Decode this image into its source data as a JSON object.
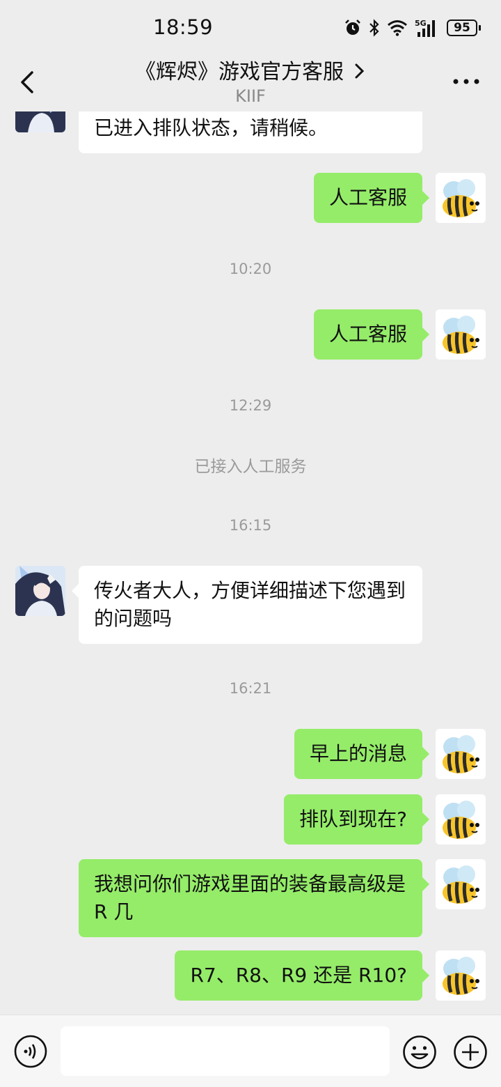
{
  "status_bar": {
    "time": "18:59",
    "battery": "95",
    "network": "5G"
  },
  "header": {
    "title": "《辉烬》游戏官方客服",
    "subtitle": "KIIF"
  },
  "messages": [
    {
      "side": "in",
      "text": "当前人工坐席繁忙，请耐心等待，您已进入排队状态，请稍候。"
    },
    {
      "side": "out",
      "text": "人工客服"
    },
    {
      "timestamp": "10:20"
    },
    {
      "side": "out",
      "text": "人工客服"
    },
    {
      "timestamp": "12:29"
    },
    {
      "system": "已接入人工服务"
    },
    {
      "timestamp": "16:15"
    },
    {
      "side": "in",
      "text": "传火者大人，方便详细描述下您遇到的问题吗"
    },
    {
      "timestamp": "16:21"
    },
    {
      "side": "out",
      "text": "早上的消息"
    },
    {
      "side": "out",
      "text": "排队到现在?"
    },
    {
      "side": "out",
      "text": "我想问你们游戏里面的装备最高级是 R 几"
    },
    {
      "side": "out",
      "text": "R7、R8、R9 还是 R10?"
    }
  ],
  "icons": {
    "back": "chevron-left-icon",
    "more": "more-dots-icon",
    "voice": "voice-icon",
    "emoji": "emoji-icon",
    "plus": "plus-icon"
  },
  "colors": {
    "background": "#ededed",
    "outgoing_bubble": "#95ec69",
    "incoming_bubble": "#ffffff",
    "meta_text": "#9a9a9a"
  }
}
